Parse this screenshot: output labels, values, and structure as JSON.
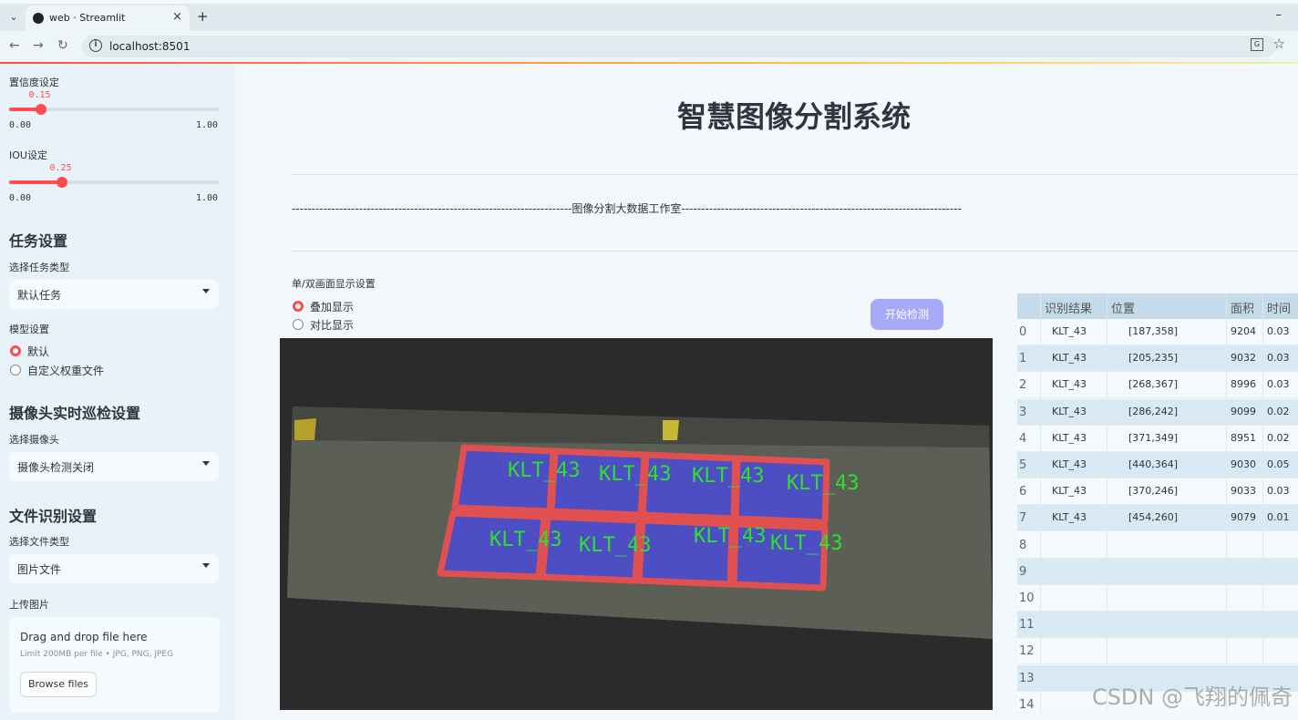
{
  "browser": {
    "tab_title": "web · Streamlit",
    "url": "localhost:8501"
  },
  "sidebar": {
    "confidence": {
      "label": "置信度设定",
      "value": "0.15",
      "min": "0.00",
      "max": "1.00",
      "fraction": 0.15
    },
    "iou": {
      "label": "IOU设定",
      "value": "0.25",
      "min": "0.00",
      "max": "1.00",
      "fraction": 0.25
    },
    "task": {
      "heading": "任务设置",
      "select_label": "选择任务类型",
      "selected": "默认任务"
    },
    "model": {
      "label": "模型设置",
      "options": [
        "默认",
        "自定义权重文件"
      ],
      "selected_index": 0
    },
    "camera": {
      "heading": "摄像头实时巡检设置",
      "select_label": "选择摄像头",
      "selected": "摄像头检测关闭"
    },
    "file": {
      "heading": "文件识别设置",
      "select_label": "选择文件类型",
      "selected": "图片文件"
    },
    "upload": {
      "label": "上传图片",
      "title": "Drag and drop file here",
      "limit": "Limit 200MB per file • JPG, PNG, JPEG",
      "button": "Browse files"
    }
  },
  "main": {
    "title": "智慧图像分割系统",
    "studio_line": "-----------------------------------------------------------------------图像分割大数据工作室-----------------------------------------------------------------------",
    "display_label": "单/双画面显示设置",
    "display_options": [
      "叠加显示",
      "对比显示"
    ],
    "display_selected_index": 0,
    "detect_button": "开始检测",
    "detection_label": "KLT_43",
    "colors": {
      "mask": "#4b4bd0",
      "outline": "#e05050",
      "label": "#2ee02e",
      "accent": "#ff4b4b"
    }
  },
  "table": {
    "headers": [
      "识别结果",
      "位置",
      "面积",
      "时间"
    ],
    "rows": [
      {
        "idx": "0",
        "result": "KLT_43",
        "position": "[187,358]",
        "area": "9204",
        "time": "0.03"
      },
      {
        "idx": "1",
        "result": "KLT_43",
        "position": "[205,235]",
        "area": "9032",
        "time": "0.03"
      },
      {
        "idx": "2",
        "result": "KLT_43",
        "position": "[268,367]",
        "area": "8996",
        "time": "0.03"
      },
      {
        "idx": "3",
        "result": "KLT_43",
        "position": "[286,242]",
        "area": "9099",
        "time": "0.02"
      },
      {
        "idx": "4",
        "result": "KLT_43",
        "position": "[371,349]",
        "area": "8951",
        "time": "0.02"
      },
      {
        "idx": "5",
        "result": "KLT_43",
        "position": "[440,364]",
        "area": "9030",
        "time": "0.05"
      },
      {
        "idx": "6",
        "result": "KLT_43",
        "position": "[370,246]",
        "area": "9033",
        "time": "0.03"
      },
      {
        "idx": "7",
        "result": "KLT_43",
        "position": "[454,260]",
        "area": "9079",
        "time": "0.01"
      },
      {
        "idx": "8",
        "result": "",
        "position": "",
        "area": "",
        "time": ""
      },
      {
        "idx": "9",
        "result": "",
        "position": "",
        "area": "",
        "time": ""
      },
      {
        "idx": "10",
        "result": "",
        "position": "",
        "area": "",
        "time": ""
      },
      {
        "idx": "11",
        "result": "",
        "position": "",
        "area": "",
        "time": ""
      },
      {
        "idx": "12",
        "result": "",
        "position": "",
        "area": "",
        "time": ""
      },
      {
        "idx": "13",
        "result": "",
        "position": "",
        "area": "",
        "time": ""
      },
      {
        "idx": "14",
        "result": "",
        "position": "",
        "area": "",
        "time": ""
      }
    ]
  },
  "watermark": "CSDN @飞翔的佩奇"
}
